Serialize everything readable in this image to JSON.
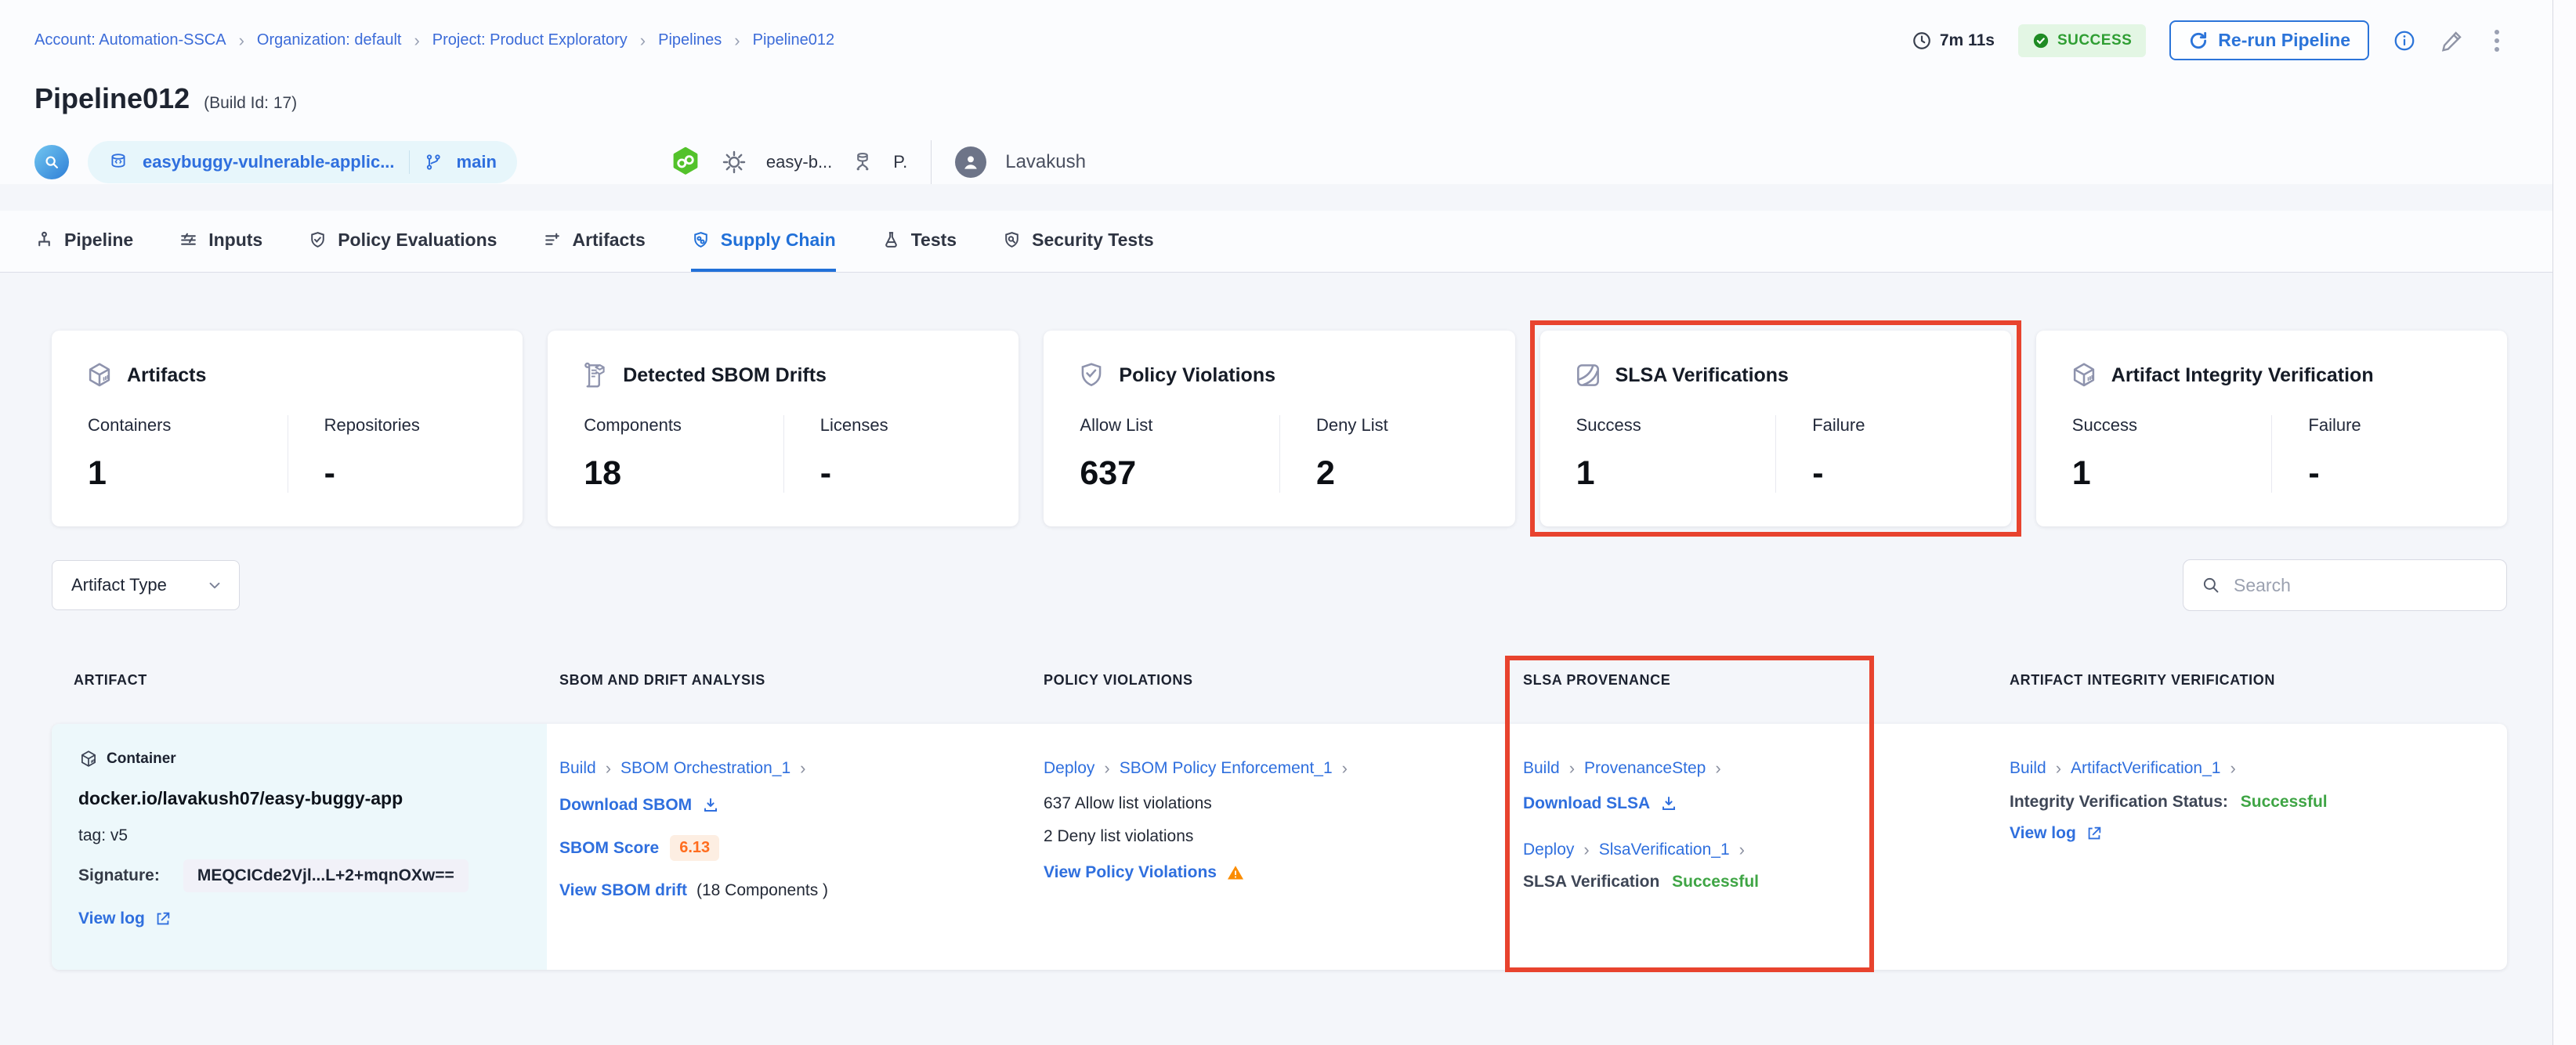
{
  "glyphs": {
    "chevron": "›"
  },
  "breadcrumb": {
    "items": [
      "Account: Automation-SSCA",
      "Organization: default",
      "Project: Product Exploratory",
      "Pipelines",
      "Pipeline012"
    ]
  },
  "toolbar": {
    "duration": "7m 11s",
    "status": "SUCCESS",
    "rerun_label": "Re-run Pipeline"
  },
  "header": {
    "title": "Pipeline012",
    "build_id": "(Build Id: 17)",
    "repo_name": "easybuggy-vulnerable-applic...",
    "branch": "main",
    "trigger_name": "easy-b...",
    "trigger_abbrev": "P.",
    "user_name": "Lavakush"
  },
  "tabs": [
    {
      "label": "Pipeline"
    },
    {
      "label": "Inputs"
    },
    {
      "label": "Policy Evaluations"
    },
    {
      "label": "Artifacts"
    },
    {
      "label": "Supply Chain"
    },
    {
      "label": "Tests"
    },
    {
      "label": "Security Tests"
    }
  ],
  "summary_cards": [
    {
      "title": "Artifacts",
      "icon": "cube-icon",
      "stats": [
        {
          "label": "Containers",
          "value": "1"
        },
        {
          "label": "Repositories",
          "value": "-"
        }
      ]
    },
    {
      "title": "Detected SBOM Drifts",
      "icon": "sbom-scroll-icon",
      "stats": [
        {
          "label": "Components",
          "value": "18"
        },
        {
          "label": "Licenses",
          "value": "-"
        }
      ]
    },
    {
      "title": "Policy Violations",
      "icon": "shield-check-icon",
      "stats": [
        {
          "label": "Allow List",
          "value": "637"
        },
        {
          "label": "Deny List",
          "value": "2"
        }
      ]
    },
    {
      "title": "SLSA Verifications",
      "icon": "slsa-icon",
      "highlighted": true,
      "stats": [
        {
          "label": "Success",
          "value": "1"
        },
        {
          "label": "Failure",
          "value": "-"
        }
      ]
    },
    {
      "title": "Artifact Integrity Verification",
      "icon": "cube-icon",
      "stats": [
        {
          "label": "Success",
          "value": "1"
        },
        {
          "label": "Failure",
          "value": "-"
        }
      ]
    }
  ],
  "filters": {
    "artifact_type": "Artifact Type",
    "search_placeholder": "Search"
  },
  "table": {
    "columns": [
      "ARTIFACT",
      "SBOM AND DRIFT ANALYSIS",
      "POLICY VIOLATIONS",
      "SLSA PROVENANCE",
      "ARTIFACT INTEGRITY VERIFICATION"
    ],
    "row": {
      "artifact": {
        "type": "Container",
        "name": "docker.io/lavakush07/easy-buggy-app",
        "tag": "tag: v5",
        "signature_label": "Signature:",
        "signature_value": "MEQCICde2Vjl...L+2+mqnOXw==",
        "view_log": "View log"
      },
      "sbom": {
        "stage": "Build",
        "step": "SBOM Orchestration_1",
        "download_label": "Download SBOM",
        "score_label": "SBOM Score",
        "score_value": "6.13",
        "drift_link": "View SBOM drift",
        "drift_note": "(18 Components )"
      },
      "policy": {
        "stage": "Deploy",
        "step": "SBOM Policy Enforcement_1",
        "allow_text": "637 Allow list violations",
        "deny_text": "2 Deny list violations",
        "view_link": "View Policy Violations"
      },
      "slsa": {
        "stage_1": "Build",
        "step_1": "ProvenanceStep",
        "download_label": "Download SLSA",
        "stage_2": "Deploy",
        "step_2": "SlsaVerification_1",
        "status_label": "SLSA Verification",
        "status_value": "Successful"
      },
      "integrity": {
        "stage": "Build",
        "step": "ArtifactVerification_1",
        "status_label": "Integrity Verification Status:",
        "status_value": "Successful",
        "view_log": "View log"
      }
    }
  },
  "colors": {
    "accent_blue": "#2f6fde",
    "active_tab_blue": "#2170d8",
    "success_green": "#3fa545",
    "success_badge_bg": "#e3f6e4",
    "highlight_red": "#e8432e",
    "score_orange": "#ff6d1f",
    "score_badge_bg": "#fdeee2",
    "warning_orange": "#fb8c00",
    "artifact_cell_bg": "#edf8fb"
  }
}
